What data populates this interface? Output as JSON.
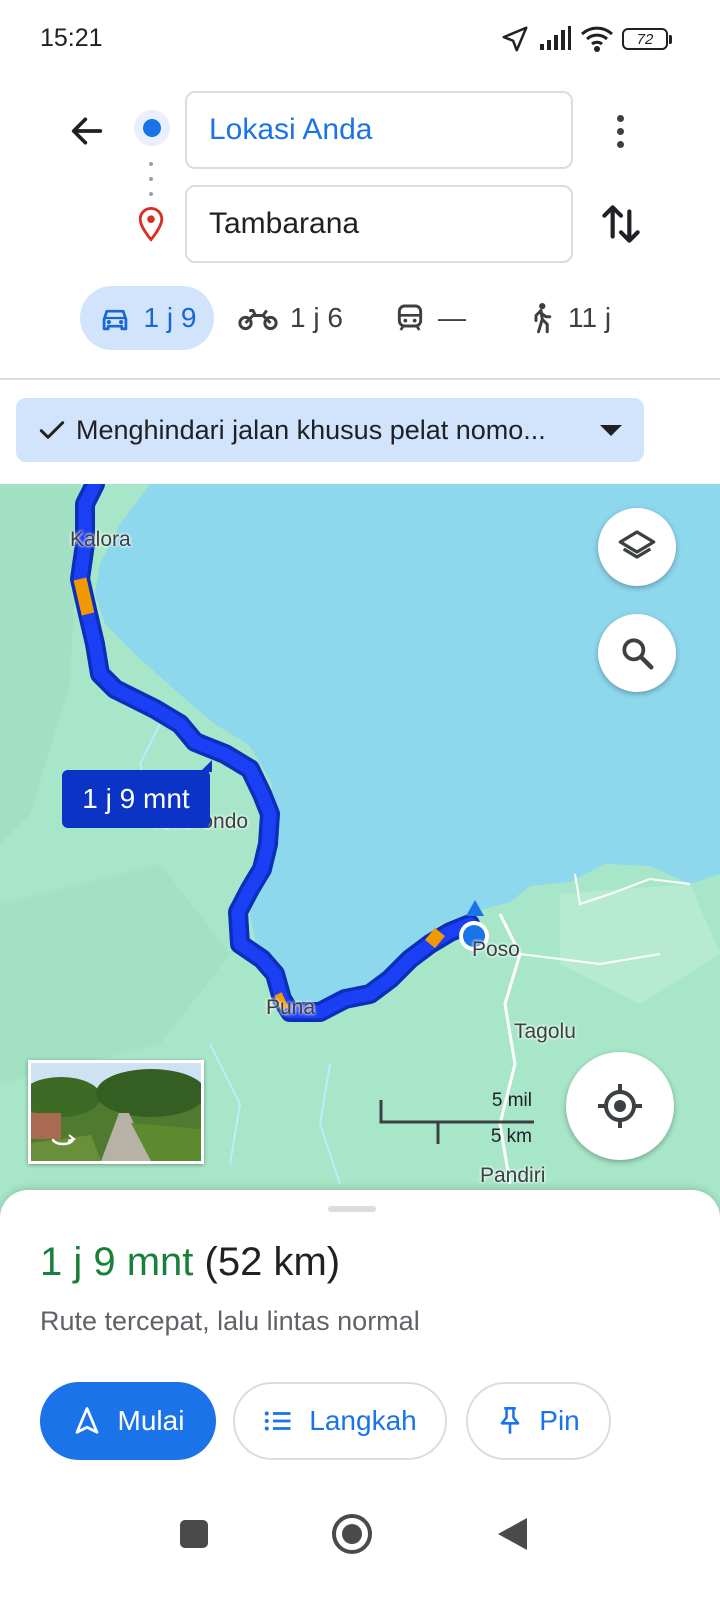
{
  "status_bar": {
    "time": "15:21",
    "battery": "72",
    "icons": [
      "location-arrow-icon",
      "signal-icon",
      "wifi-icon",
      "battery-icon"
    ]
  },
  "directions": {
    "origin": "Lokasi Anda",
    "destination": "Tambarana",
    "modes": [
      {
        "icon": "car-icon",
        "label": "1 j 9",
        "active": true
      },
      {
        "icon": "motorcycle-icon",
        "label": "1 j 6",
        "active": false
      },
      {
        "icon": "train-icon",
        "label": "—",
        "active": false
      },
      {
        "icon": "walk-icon",
        "label": "11 j",
        "active": false
      }
    ]
  },
  "filter_chip": {
    "label": "Menghindari jalan khusus pelat nomo..."
  },
  "map": {
    "labels": {
      "kalora": "Kalora",
      "tokorondo": "Tokorondo",
      "poso": "Poso",
      "puna": "Puna",
      "tagolu": "Tagolu",
      "pandiri": "Pandiri"
    },
    "eta_bubble": "1 j 9 mnt",
    "scale": {
      "miles": "5 mil",
      "km": "5 km"
    },
    "colors": {
      "water": "#8ed8ee",
      "land": "#a8e6c9",
      "route": "#1a3ff5",
      "traffic": "#f29900"
    }
  },
  "route_summary": {
    "duration": "1 j 9 mnt",
    "distance": "(52 km)",
    "description": "Rute tercepat, lalu lintas normal"
  },
  "actions": {
    "start": "Mulai",
    "steps": "Langkah",
    "pin": "Pin"
  },
  "colors": {
    "accent": "#1a73e8",
    "duration_green": "#188038",
    "chip_bg": "#d2e3fc"
  }
}
